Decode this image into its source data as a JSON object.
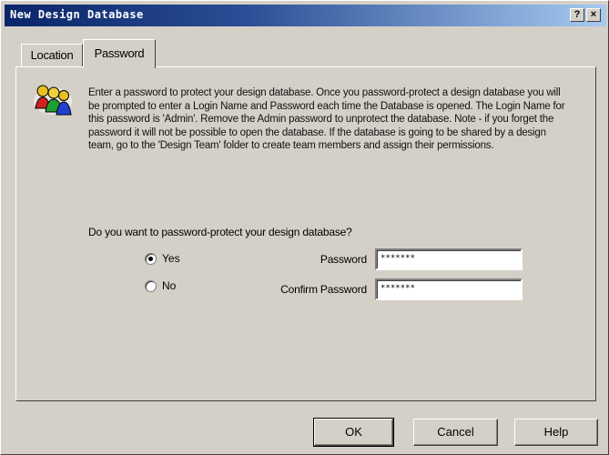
{
  "window": {
    "title": "New Design Database",
    "help_button": "?",
    "close_button": "×"
  },
  "tabs": [
    {
      "label": "Location",
      "active": false
    },
    {
      "label": "Password",
      "active": true
    }
  ],
  "password_tab": {
    "description": "Enter a password to protect your design database. Once you password-protect a design database you will be prompted to enter a Login Name and Password each time the Database is opened. The Login Name for this password is 'Admin'. Remove the Admin password to unprotect the database. Note - if you forget the password it will not be possible to open the database.  If the database is going to be shared by a design team, go to the 'Design Team' folder to create team members and assign their permissions.",
    "question": "Do you want to password-protect your design database?",
    "options": [
      {
        "label": "Yes",
        "selected": true
      },
      {
        "label": "No",
        "selected": false
      }
    ],
    "password_label": "Password",
    "password_value": "*******",
    "confirm_label": "Confirm Password",
    "confirm_value": "*******"
  },
  "buttons": {
    "ok": "OK",
    "cancel": "Cancel",
    "help": "Help"
  },
  "colors": {
    "titlebar_start": "#0a246a",
    "titlebar_end": "#a6caf0",
    "face": "#d4d0c8"
  }
}
